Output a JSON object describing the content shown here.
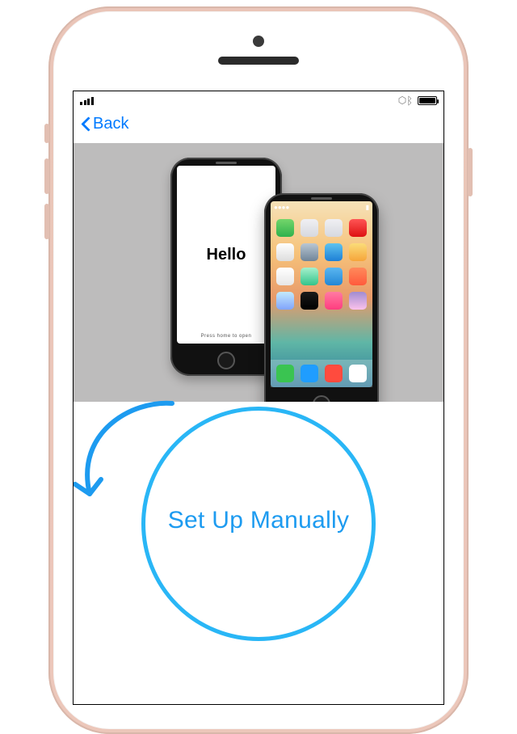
{
  "nav": {
    "back_label": "Back"
  },
  "hero": {
    "hello_text": "Hello",
    "press_home_text": "Press home to open"
  },
  "actions": {
    "setup_manually_label": "Set Up Manually"
  },
  "colors": {
    "accent_blue": "#007aff",
    "highlight_blue": "#29b6f6"
  }
}
